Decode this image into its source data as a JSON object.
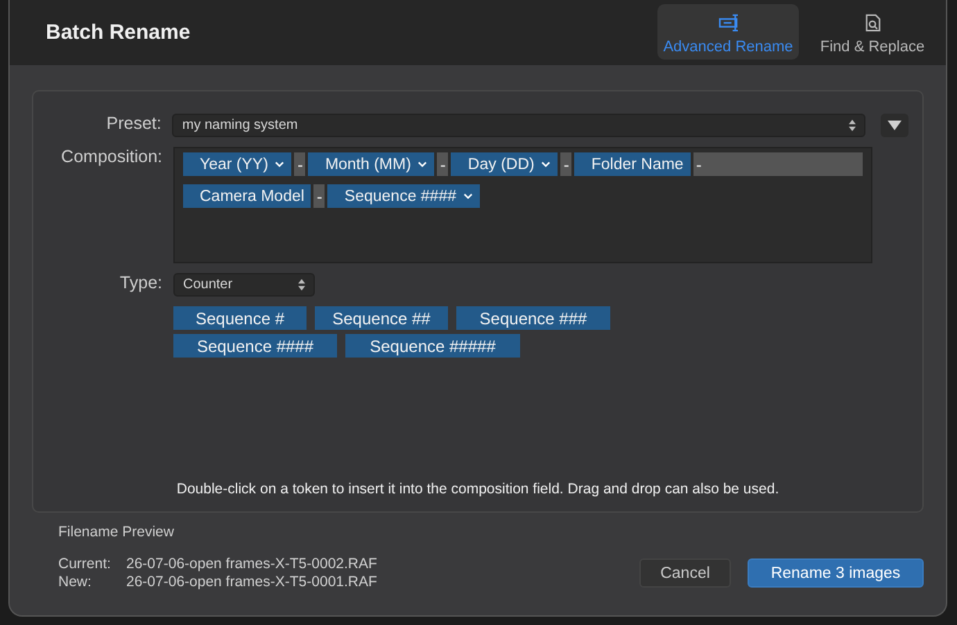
{
  "window": {
    "title": "Batch Rename"
  },
  "tabs": [
    {
      "label": "Advanced Rename",
      "selected": true
    },
    {
      "label": "Find & Replace",
      "selected": false
    }
  ],
  "preset": {
    "label": "Preset:",
    "value": "my naming system"
  },
  "composition": {
    "label": "Composition:",
    "tokens": [
      {
        "kind": "token",
        "text": "Year (YY)",
        "dropdown": true
      },
      {
        "kind": "separator",
        "text": "-"
      },
      {
        "kind": "token",
        "text": "Month (MM)",
        "dropdown": true
      },
      {
        "kind": "separator",
        "text": "-"
      },
      {
        "kind": "token",
        "text": "Day (DD)",
        "dropdown": true
      },
      {
        "kind": "separator",
        "text": "-"
      },
      {
        "kind": "token",
        "text": "Folder Name",
        "dropdown": false
      },
      {
        "kind": "input",
        "text": "-"
      },
      {
        "kind": "break"
      },
      {
        "kind": "token",
        "text": "Camera Model",
        "dropdown": false
      },
      {
        "kind": "separator",
        "text": "-"
      },
      {
        "kind": "token",
        "text": "Sequence ####",
        "dropdown": true
      }
    ]
  },
  "type": {
    "label": "Type:",
    "value": "Counter",
    "tokens": [
      "Sequence #",
      "Sequence ##",
      "Sequence ###",
      "Sequence ####",
      "Sequence #####"
    ]
  },
  "hint": "Double-click on a token to insert it into the composition field. Drag and drop can also be used.",
  "preview": {
    "title": "Filename Preview",
    "rows": [
      {
        "label": "Current:",
        "value": "26-07-06-open frames-X-T5-0002.RAF"
      },
      {
        "label": "New:",
        "value": "26-07-06-open frames-X-T5-0001.RAF"
      }
    ]
  },
  "buttons": [
    {
      "label": "Cancel",
      "primary": false
    },
    {
      "label": "Rename 3 images",
      "primary": true
    }
  ]
}
